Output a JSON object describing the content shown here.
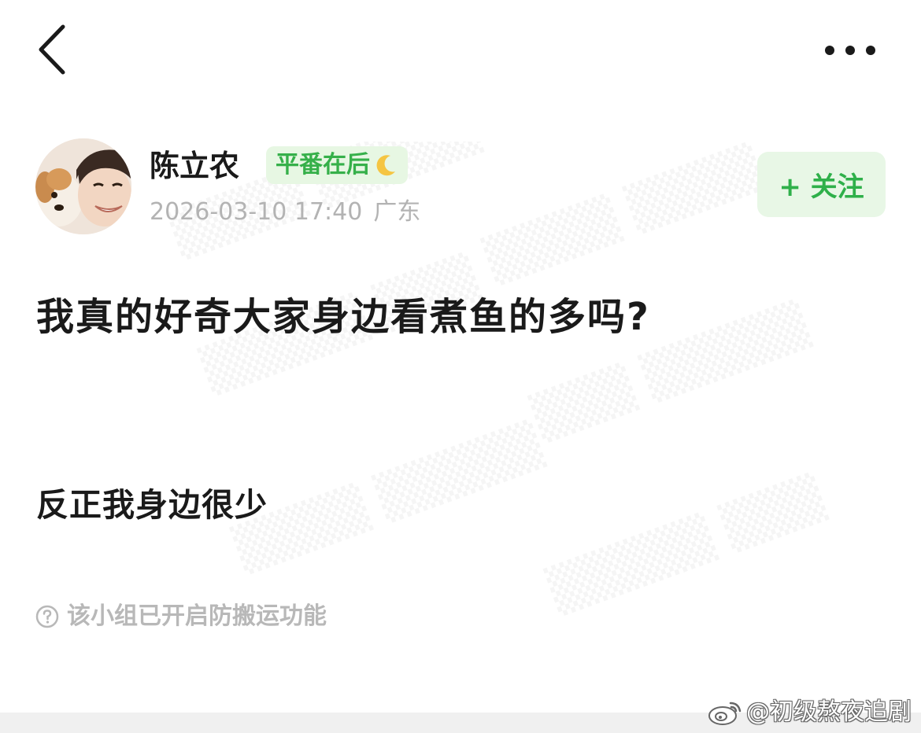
{
  "user": {
    "name": "陈立农",
    "tag": "平番在后",
    "timestamp": "2026-03-10 17:40",
    "location": "广东",
    "follow_label": "+ 关注"
  },
  "post": {
    "title": "我真的好奇大家身边看煮鱼的多吗?",
    "body": "反正我身边很少"
  },
  "notice": {
    "text": "该小组已开启防搬运功能"
  },
  "watermark_credit": "@初级熬夜追剧",
  "colors": {
    "accent_green": "#2fb04a",
    "badge_bg": "#e7f7e3",
    "muted_text": "#b3b3b3",
    "moon": "#f5c542"
  },
  "icons": [
    "back-arrow-icon",
    "more-dots-icon",
    "moon-icon",
    "help-circle-icon",
    "weibo-logo-icon"
  ]
}
